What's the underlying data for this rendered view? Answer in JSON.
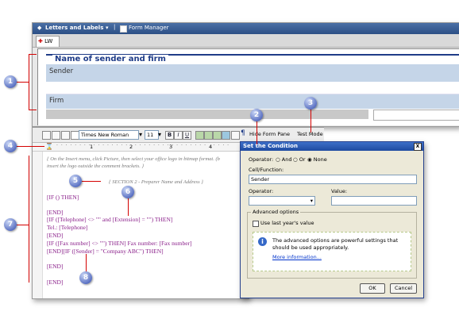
{
  "app": {
    "title": "Letters and Labels",
    "form_manager_label": "Form Manager",
    "doc_tab": "LW"
  },
  "form": {
    "section_title": "Name of sender and firm",
    "sender_label": "Sender",
    "firm_label": "Firm"
  },
  "toolbar": {
    "font_name": "Times New Roman",
    "font_size": "11",
    "bold": "B",
    "italic": "I",
    "underline": "U",
    "hide_form_pane": "Hide Form Pane",
    "test_mode": "Test Mode"
  },
  "ruler": {
    "marks": [
      "1",
      "2",
      "3",
      "4"
    ]
  },
  "editor": {
    "comment_line1": "{ On the Insert menu, click Picture, then select your office logo in bitmap format. (b",
    "comment_line2": "insert the logo outside the comment brackets. }",
    "section_label": "{ SECTION 2 - Preparer Name and Address }",
    "lines": [
      "[IF () THEN]",
      "[END]",
      "[IF ([Telephone] <> \"\" and [Extension]  =  \"\") THEN]",
      "Tel.: [Telephone]",
      "[END]",
      "[IF ([Fax number] <> \"\") THEN] Fax number: [Fax number]",
      "[END][IF ([Sender] = \"Company ABC\") THEN]",
      "[END]",
      "[END]"
    ]
  },
  "dialog": {
    "title": "Set the Condition",
    "close_glyph": "X",
    "operator_label": "Operator:",
    "radio_and": "And",
    "radio_or": "Or",
    "radio_none": "None",
    "cell_label": "Cell/Function:",
    "cell_value": "Sender",
    "operator2_label": "Operator:",
    "value_label": "Value:",
    "advanced_label": "Advanced options",
    "checkbox_label": "Use last year's value",
    "info_text_1": "The advanced options are powerful settings that",
    "info_text_2": "should be used appropriately.",
    "more_info": "More information...",
    "ok": "OK",
    "cancel": "Cancel"
  },
  "callouts": [
    "1",
    "2",
    "3",
    "4",
    "5",
    "6",
    "7",
    "8"
  ],
  "colors": {
    "callout": "#5d73c4",
    "leader": "#d40000",
    "code": "#8a1f8a",
    "dialog_title": "#1e4aa0"
  }
}
